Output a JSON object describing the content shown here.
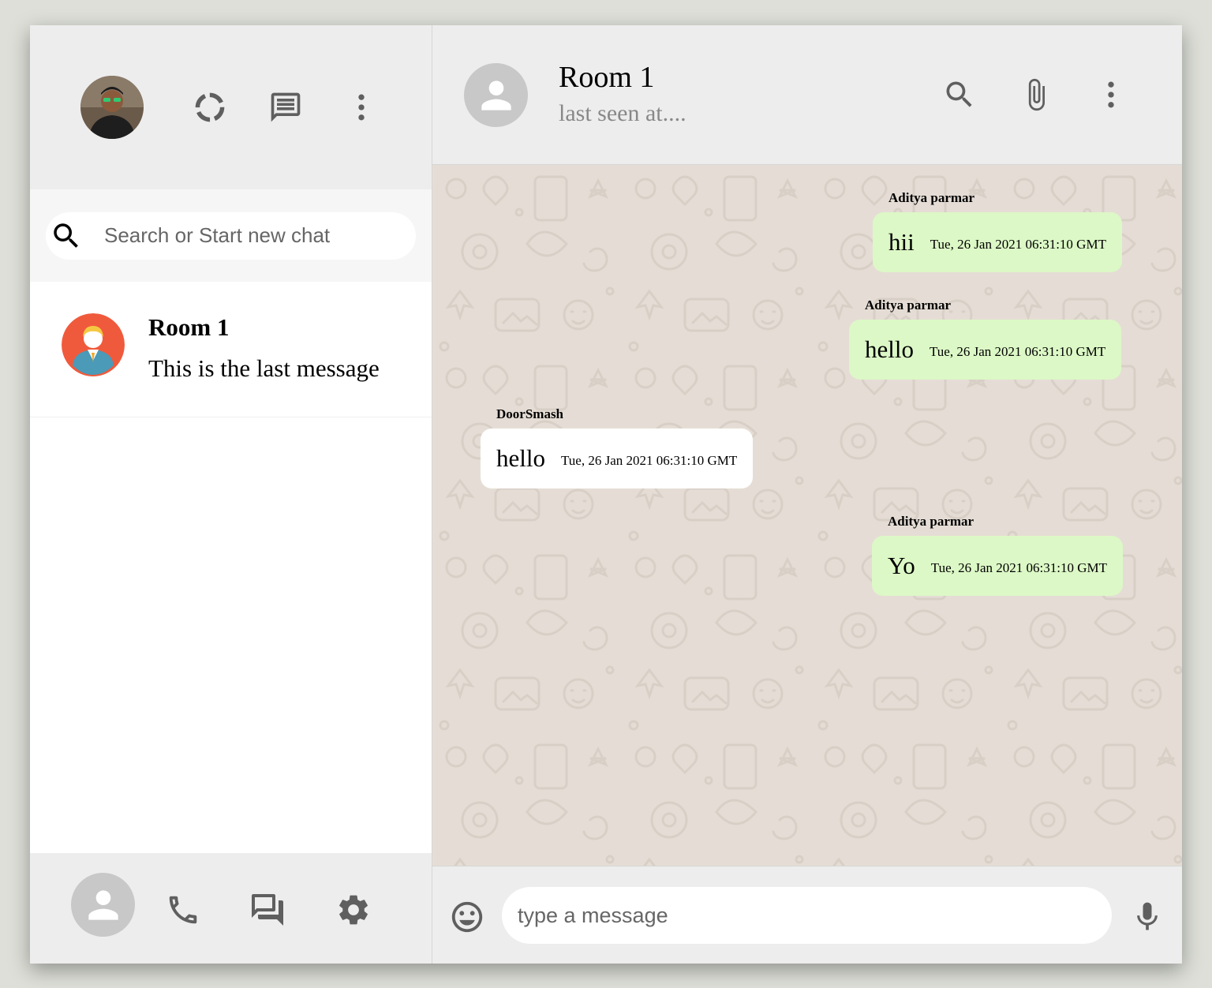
{
  "sidebar": {
    "header": {
      "avatar_icon": "user-photo",
      "icons": [
        "status-icon",
        "new-chat-icon",
        "more-vert-icon"
      ]
    },
    "search": {
      "placeholder": "Search or Start new chat",
      "value": ""
    },
    "chats": [
      {
        "name": "Room 1",
        "last_message": "This is the last message"
      }
    ],
    "footer": {
      "icons": [
        "account-icon",
        "phone-icon",
        "forum-icon",
        "settings-icon"
      ]
    }
  },
  "chat": {
    "header": {
      "title": "Room 1",
      "subtitle": "last seen at....",
      "icons": [
        "search-icon",
        "attach-icon",
        "more-vert-icon"
      ]
    },
    "messages": [
      {
        "sender": "Aditya parmar",
        "text": "hii",
        "time": "Tue, 26 Jan 2021 06:31:10 GMT",
        "direction": "sent"
      },
      {
        "sender": "Aditya parmar",
        "text": "hello",
        "time": "Tue, 26 Jan 2021 06:31:10 GMT",
        "direction": "sent"
      },
      {
        "sender": "DoorSmash",
        "text": "hello",
        "time": "Tue, 26 Jan 2021 06:31:10 GMT",
        "direction": "received"
      },
      {
        "sender": "Aditya parmar",
        "text": "Yo",
        "time": "Tue, 26 Jan 2021 06:31:10 GMT",
        "direction": "sent"
      }
    ],
    "footer": {
      "placeholder": "type a message",
      "value": "",
      "icons": [
        "emoji-icon",
        "mic-icon"
      ]
    }
  },
  "colors": {
    "background": "#dddfd8",
    "panel": "#ededed",
    "sent_bubble": "#dcf8c6",
    "received_bubble": "#ffffff",
    "chat_bg": "#e5ddd5",
    "icon": "#5f5f5f",
    "room_avatar": "#f05a3c"
  }
}
